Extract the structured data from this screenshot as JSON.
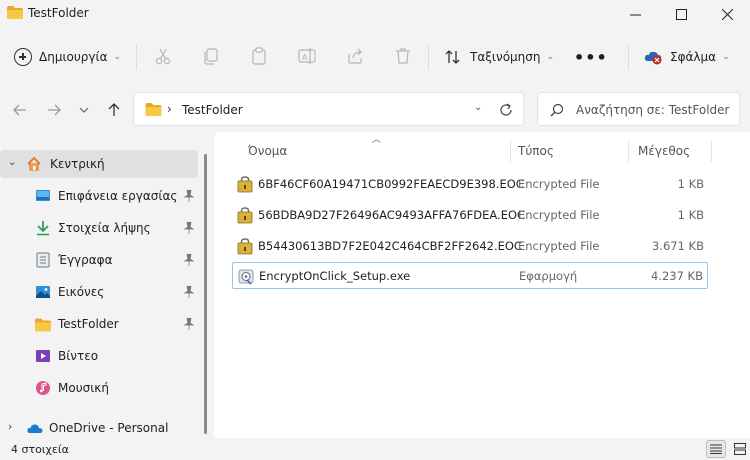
{
  "window": {
    "title": "TestFolder"
  },
  "toolbar": {
    "new_label": "Δημιουργία",
    "sort_label": "Ταξινόμηση",
    "more_label": "•••",
    "error_label": "Σφάλμα"
  },
  "address": {
    "path": "TestFolder",
    "separator": "›"
  },
  "search": {
    "placeholder": "Αναζήτηση σε: TestFolder"
  },
  "sidebar": {
    "items": [
      {
        "label": "Κεντρική",
        "icon": "home-icon",
        "pinned": false
      },
      {
        "label": "Επιφάνεια εργασίας",
        "icon": "desktop-icon",
        "pinned": true
      },
      {
        "label": "Στοιχεία λήψης",
        "icon": "download-icon",
        "pinned": true
      },
      {
        "label": "Έγγραφα",
        "icon": "documents-icon",
        "pinned": true
      },
      {
        "label": "Εικόνες",
        "icon": "pictures-icon",
        "pinned": true
      },
      {
        "label": "TestFolder",
        "icon": "folder-icon",
        "pinned": true
      },
      {
        "label": "Βίντεο",
        "icon": "videos-icon",
        "pinned": false
      },
      {
        "label": "Μουσική",
        "icon": "music-icon",
        "pinned": false
      },
      {
        "label": "OneDrive - Personal",
        "icon": "onedrive-icon",
        "pinned": false
      }
    ]
  },
  "columns": {
    "name": "Όνομα",
    "type": "Τύπος",
    "size": "Μέγεθος"
  },
  "files": [
    {
      "name": "6BF46CF60A19471CB0992FEAECD9E398.EOC",
      "type": "Encrypted File",
      "size": "1 KB",
      "icon": "encrypted-file-icon"
    },
    {
      "name": "56BDBA9D27F26496AC9493AFFA76FDEA.EOC",
      "type": "Encrypted File",
      "size": "1 KB",
      "icon": "encrypted-file-icon"
    },
    {
      "name": "B54430613BD7F2E042C464CBF2FF2642.EOC",
      "type": "Encrypted File",
      "size": "3.671 KB",
      "icon": "encrypted-file-icon"
    },
    {
      "name": "EncryptOnClick_Setup.exe",
      "type": "Εφαρμογή",
      "size": "4.237 KB",
      "icon": "installer-icon"
    }
  ],
  "status": {
    "item_count": "4 στοιχεία"
  },
  "colors": {
    "accent": "#0067c0",
    "selected_border": "#99c5ea",
    "folder": "#f3c13a"
  }
}
